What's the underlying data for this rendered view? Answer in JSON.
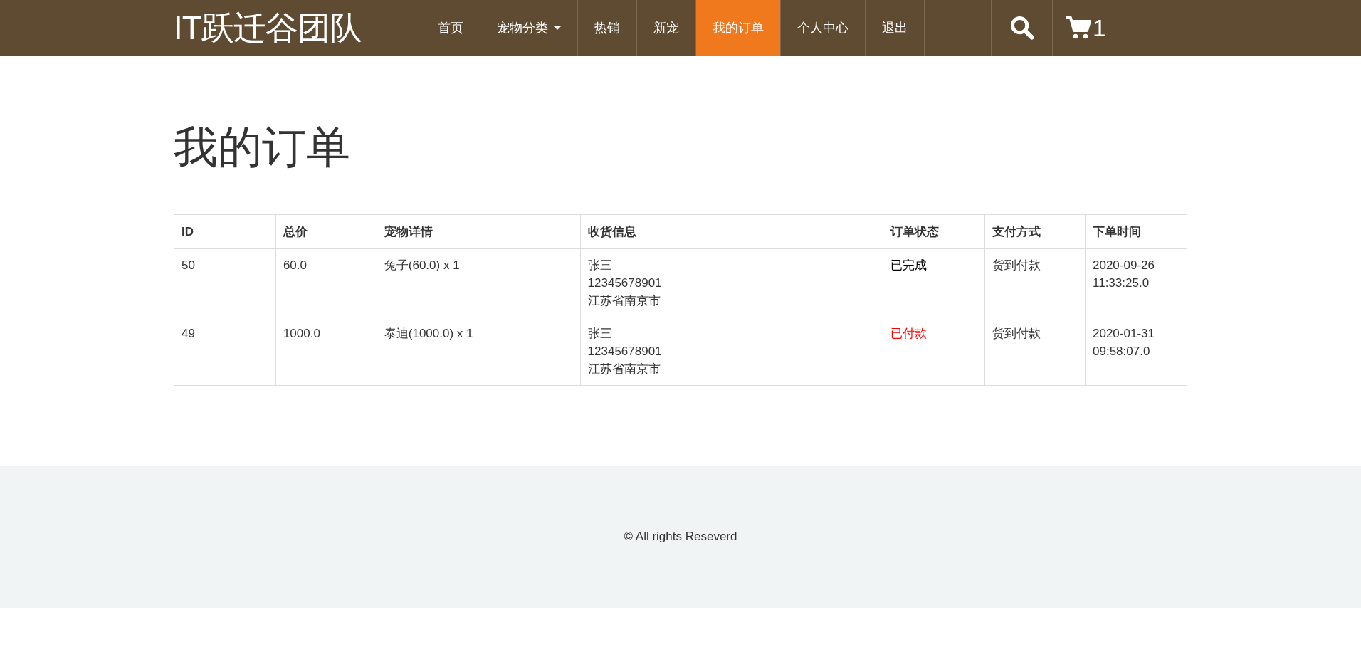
{
  "navbar": {
    "brand": "IT跃迁谷团队",
    "items": [
      {
        "label": "首页",
        "selected": false,
        "dropdown": false
      },
      {
        "label": "宠物分类",
        "selected": false,
        "dropdown": true
      },
      {
        "label": "热销",
        "selected": false,
        "dropdown": false
      },
      {
        "label": "新宠",
        "selected": false,
        "dropdown": false
      },
      {
        "label": "我的订单",
        "selected": true,
        "dropdown": false
      },
      {
        "label": "个人中心",
        "selected": false,
        "dropdown": false
      },
      {
        "label": "退出",
        "selected": false,
        "dropdown": false
      }
    ],
    "cart_count": "1"
  },
  "page_title": "我的订单",
  "table": {
    "columns": [
      "ID",
      "总价",
      "宠物详情",
      "收货信息",
      "订单状态",
      "支付方式",
      "下单时间"
    ],
    "rows": [
      {
        "id": "50",
        "total": "60.0",
        "pets": "兔子(60.0) x 1",
        "address": [
          "张三",
          "12345678901",
          "江苏省南京市"
        ],
        "status": {
          "text": "已完成",
          "color": "#000000"
        },
        "payment": "货到付款",
        "time": [
          "2020-09-26",
          "11:33:25.0"
        ]
      },
      {
        "id": "49",
        "total": "1000.0",
        "pets": "泰迪(1000.0) x 1",
        "address": [
          "张三",
          "12345678901",
          "江苏省南京市"
        ],
        "status": {
          "text": "已付款",
          "color": "#ff0000"
        },
        "payment": "货到付款",
        "time": [
          "2020-01-31",
          "09:58:07.0"
        ]
      }
    ]
  },
  "footer": "© All rights Reseverd"
}
